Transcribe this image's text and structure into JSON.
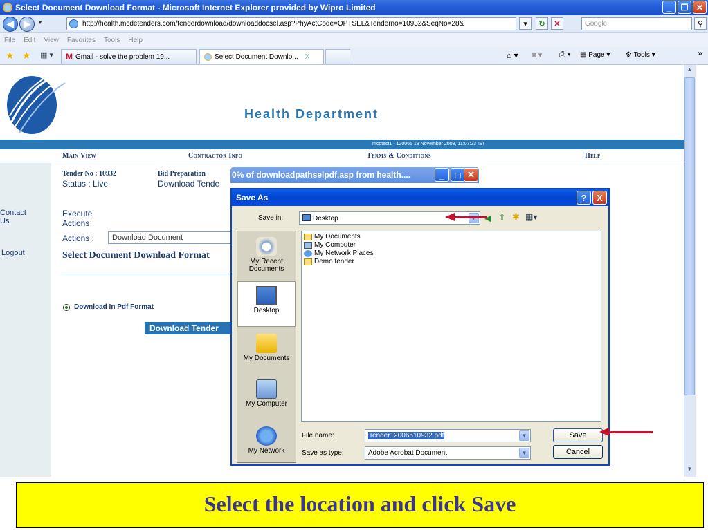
{
  "browser": {
    "window_title": "Select Document Download Format - Microsoft Internet Explorer provided by Wipro Limited",
    "url": "http://health.mcdetenders.com/tenderdownload/downloaddocsel.asp?PhyActCode=OPTSEL&Tenderno=10932&SeqNo=28&",
    "search_placeholder": "Google",
    "menu": [
      "File",
      "Edit",
      "View",
      "Favorites",
      "Tools",
      "Help"
    ],
    "tabs": [
      {
        "label": "Gmail - solve the problem 19..."
      },
      {
        "label": "Select Document Downlo..."
      }
    ],
    "tab_close": "X",
    "toolbar": {
      "page_label": "Page",
      "tools_label": "Tools",
      "chevron": "»"
    }
  },
  "site": {
    "title": "Health Department",
    "user_info": "mcdtest1 - 120065    18 November 2008,  11:07:23  IST",
    "nav": [
      "Main View",
      "Contractor Info",
      "Terms & Conditions",
      "Help"
    ],
    "sidebar": [
      "Contact Us",
      "Logout"
    ],
    "tender_no": "Tender No : 10932",
    "status": "Status : Live",
    "bid_preparation": "Bid Preparation",
    "download_tender_link": "Download Tende",
    "execute": "Execute",
    "actions_link": "Actions",
    "actions_label": "Actions :",
    "actions_value": "Download Document",
    "section_heading": "Select Document Download Format",
    "radio_label": "Download In Pdf Format",
    "download_button": "Download Tender"
  },
  "progress_window": {
    "title": "0% of downloadpathselpdf.asp from health...."
  },
  "dialog": {
    "title": "Save As",
    "help_btn": "?",
    "close_btn": "X",
    "save_in_label": "Save in:",
    "save_in_value": "Desktop",
    "places": [
      "My Recent Documents",
      "Desktop",
      "My Documents",
      "My Computer",
      "My Network"
    ],
    "files": [
      "My Documents",
      "My Computer",
      "My Network Places",
      "Demo tender"
    ],
    "file_name_label": "File name:",
    "file_name_value": "Tender12006510932.pdf",
    "save_type_label": "Save as type:",
    "save_type_value": "Adobe Acrobat Document",
    "save_button": "Save",
    "cancel_button": "Cancel"
  },
  "caption": "Select the location and click Save",
  "colors": {
    "caption_bg": "#ffff00",
    "caption_text": "#3a3590",
    "arrow": "#c8102e",
    "site_blue": "#2674b4"
  }
}
